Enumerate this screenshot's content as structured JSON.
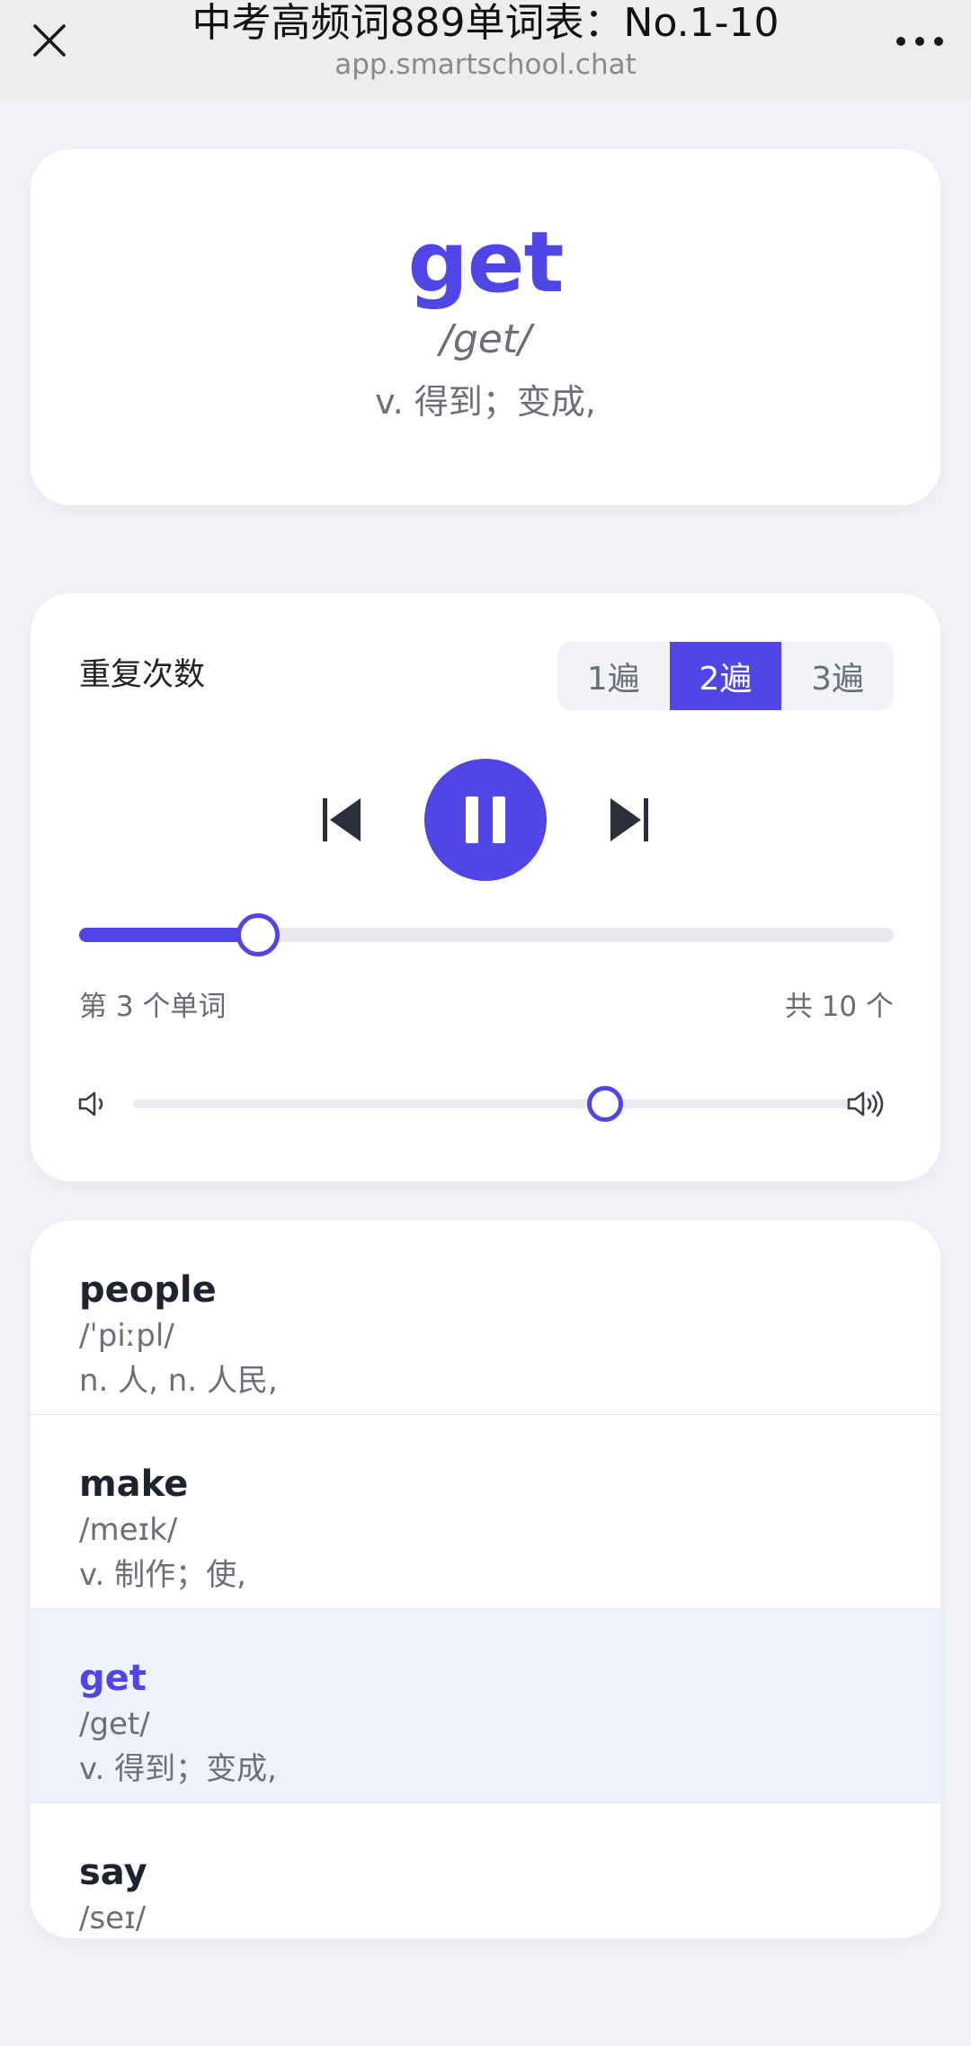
{
  "header": {
    "title": "中考高频词889单词表：No.1-10",
    "subtitle": "app.smartschool.chat",
    "close_icon": "close-icon",
    "more_icon": "more-horizontal-icon"
  },
  "current_word": {
    "word": "get",
    "phonetic": "/get/",
    "meaning": "v. 得到；变成,"
  },
  "player": {
    "repeat_label": "重复次数",
    "repeat_options": [
      "1遍",
      "2遍",
      "3遍"
    ],
    "repeat_selected": "2遍",
    "state": "playing",
    "progress": 0.22,
    "position_text": "第 3 个单词",
    "total_text": "共 10 个",
    "volume": 0.66
  },
  "word_list": [
    {
      "word": "people",
      "phonetic": "/ˈpiːpl/",
      "meaning": "n. 人, n. 人民,",
      "active": false
    },
    {
      "word": "make",
      "phonetic": "/meɪk/",
      "meaning": "v. 制作；使,",
      "active": false
    },
    {
      "word": "get",
      "phonetic": "/get/",
      "meaning": "v. 得到；变成,",
      "active": true
    },
    {
      "word": "say",
      "phonetic": "/seɪ/",
      "meaning": "",
      "active": false
    }
  ],
  "colors": {
    "accent": "#4f46e5",
    "background": "#f3f4f8",
    "active_row": "#eff1fd"
  }
}
